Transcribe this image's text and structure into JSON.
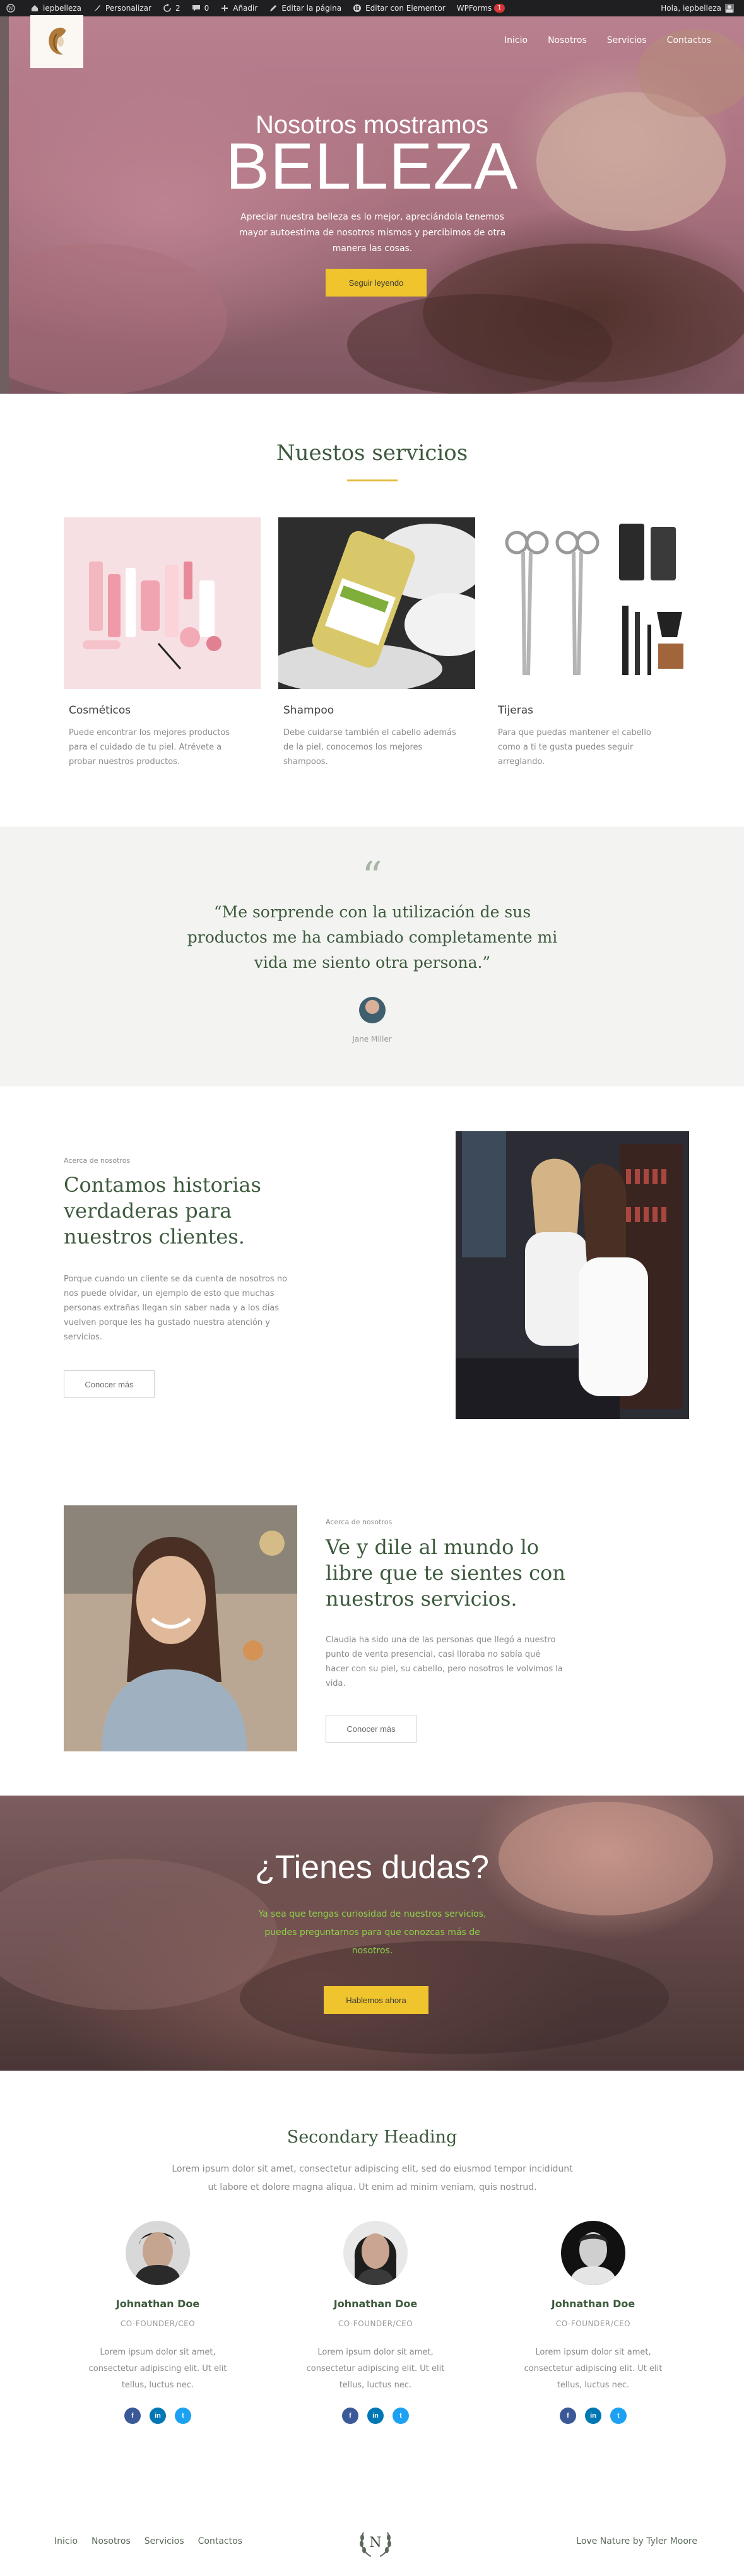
{
  "admin_bar": {
    "site_name": "iepbelleza",
    "customize": "Personalizar",
    "updates_count": "2",
    "comments_count": "0",
    "new": "Añadir",
    "edit_page": "Editar la página",
    "edit_elementor": "Editar con Elementor",
    "wpforms": "WPForms",
    "wpforms_badge": "1",
    "greeting": "Hola, iepbelleza"
  },
  "nav": {
    "items": [
      "Inicio",
      "Nosotros",
      "Servicios",
      "Contactos"
    ]
  },
  "hero": {
    "title_small": "Nosotros mostramos",
    "title_big": "BELLEZA",
    "text": "Apreciar nuestra belleza es lo mejor, apreciándola tenemos mayor autoestima de nosotros mismos y percibimos de otra manera las cosas.",
    "button": "Seguir leyendo"
  },
  "services": {
    "heading": "Nuestos servicios",
    "items": [
      {
        "title": "Cosméticos",
        "text": "Puede encontrar los mejores productos para el cuidado de tu piel. Atrévete a probar nuestros productos."
      },
      {
        "title": "Shampoo",
        "text": "Debe cuidarse también el cabello además de la piel, conocemos los mejores shampoos."
      },
      {
        "title": "Tijeras",
        "text": "Para que puedas mantener el cabello como a ti te gusta puedes seguir arreglando."
      }
    ]
  },
  "testimonial": {
    "quote": "“Me sorprende con la utilización de sus productos me ha cambiado completamente mi vida me siento otra persona.”",
    "author": "Jane Miller"
  },
  "about1": {
    "eyebrow": "Acerca de nosotros",
    "heading": "Contamos historias verdaderas para nuestros clientes.",
    "text": "Porque cuando un cliente se da cuenta de nosotros no nos puede olvidar, un ejemplo de esto que muchas personas extrañas llegan sin saber nada y a los días vuelven porque les ha gustado nuestra atención y servicios.",
    "button": "Conocer más"
  },
  "about2": {
    "eyebrow": "Acerca de nosotros",
    "heading": "Ve y dile al mundo lo libre que te sientes con nuestros servicios.",
    "text": "Claudia ha sido una de las personas que llegó a nuestro punto de venta presencial, casi lloraba no sabía qué hacer con su piel, su cabello, pero nosotros le volvimos la vida.",
    "button": "Conocer más"
  },
  "cta": {
    "title": "¿Tienes dudas?",
    "text": "Ya sea que tengas curiosidad de nuestros servicios, puedes preguntarnos para que conozcas más de nosotros.",
    "button": "Hablemos ahora"
  },
  "team": {
    "heading": "Secondary Heading",
    "subtitle": "Lorem ipsum dolor sit amet, consectetur adipiscing elit, sed do eiusmod tempor incididunt ut labore et dolore magna aliqua. Ut enim ad minim veniam, quis nostrud.",
    "members": [
      {
        "name": "Johnathan Doe",
        "role": "CO-FOUNDER/CEO",
        "text": "Lorem ipsum dolor sit amet, consectetur adipiscing elit. Ut elit tellus, luctus nec."
      },
      {
        "name": "Johnathan Doe",
        "role": "CO-FOUNDER/CEO",
        "text": "Lorem ipsum dolor sit amet, consectetur adipiscing elit. Ut elit tellus, luctus nec."
      },
      {
        "name": "Johnathan Doe",
        "role": "CO-FOUNDER/CEO",
        "text": "Lorem ipsum dolor sit amet, consectetur adipiscing elit. Ut elit tellus, luctus nec."
      }
    ],
    "social_icons": [
      "facebook-icon",
      "linkedin-icon",
      "twitter-icon"
    ]
  },
  "footer": {
    "nav": [
      "Inicio",
      "Nosotros",
      "Servicios",
      "Contactos"
    ],
    "logo_letter": "N",
    "credit": "Love Nature by Tyler Moore"
  },
  "colors": {
    "accent_gold": "#f0c42c",
    "heading_green": "#3d5a3d",
    "cta_green_text": "#8fd24a",
    "facebook": "#3b5998",
    "linkedin": "#0077b5",
    "twitter": "#1da1f2"
  }
}
